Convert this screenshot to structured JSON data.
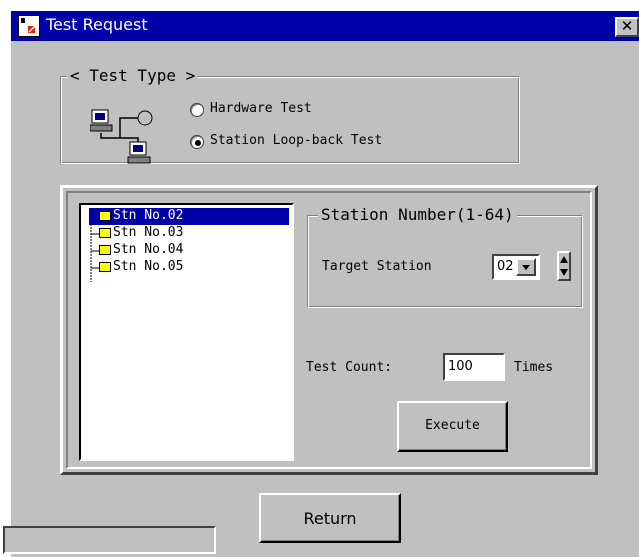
{
  "window": {
    "title": "Test Request"
  },
  "test_type": {
    "legend": "< Test Type >",
    "options": [
      {
        "label": "Hardware Test",
        "selected": false
      },
      {
        "label": "Station Loop-back Test",
        "selected": true
      }
    ]
  },
  "tree": {
    "items": [
      {
        "label": "Stn No.02",
        "selected": true
      },
      {
        "label": "Stn No.03",
        "selected": false
      },
      {
        "label": "Stn No.04",
        "selected": false
      },
      {
        "label": "Stn No.05",
        "selected": false
      }
    ]
  },
  "station_number": {
    "legend": "Station Number(1-64)",
    "target_label": "Target Station",
    "target_value": "02"
  },
  "test_count": {
    "label": "Test Count:",
    "value": "100",
    "unit": "Times"
  },
  "buttons": {
    "execute": "Execute",
    "return": "Return"
  },
  "colors": {
    "title_bar": "#0000a8",
    "selection": "#0000a8",
    "face": "#c0c0c0",
    "folder": "#ffff00"
  },
  "icons": {
    "app": "app-icon",
    "close": "close-icon",
    "network": "network-computers-icon",
    "folder": "folder-icon",
    "spin": "spin-arrows-icon",
    "dropdown": "dropdown-arrow-icon"
  }
}
